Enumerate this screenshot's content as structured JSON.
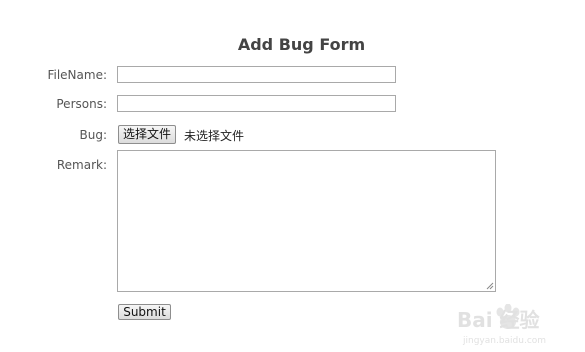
{
  "form": {
    "title": "Add Bug Form",
    "filename": {
      "label": "FileName:",
      "value": ""
    },
    "persons": {
      "label": "Persons:",
      "value": ""
    },
    "bug": {
      "label": "Bug:",
      "button_label": "选择文件",
      "status": "未选择文件"
    },
    "remark": {
      "label": "Remark:",
      "value": ""
    },
    "submit_label": "Submit"
  },
  "watermark": {
    "text": "Bai 经验",
    "url": "jingyan.baidu.com"
  }
}
